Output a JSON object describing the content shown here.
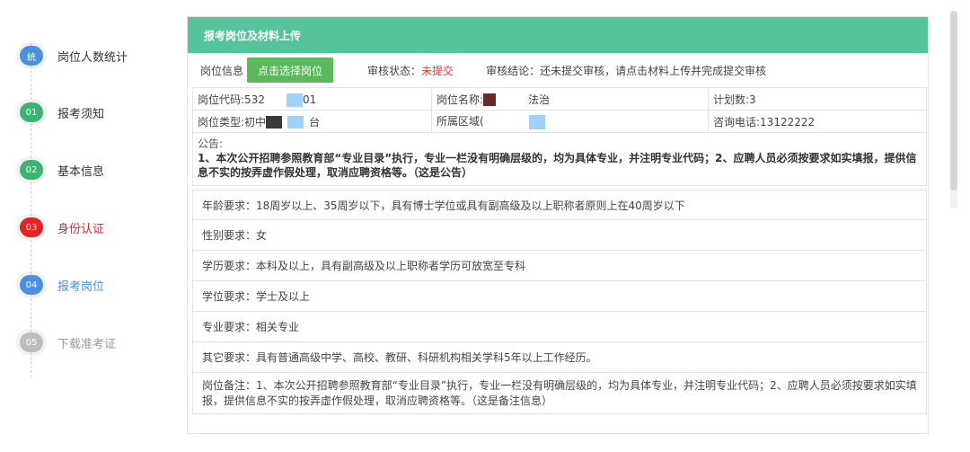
{
  "steps": [
    {
      "badge": "统",
      "label": "岗位人数统计",
      "badge_color": "#4a8fe0",
      "label_color": "#333333"
    },
    {
      "badge": "01",
      "label": "报考须知",
      "badge_color": "#3cb371",
      "label_color": "#333333"
    },
    {
      "badge": "02",
      "label": "基本信息",
      "badge_color": "#3cb371",
      "label_color": "#333333"
    },
    {
      "badge": "03",
      "label": "身份认证",
      "badge_color": "#e22424",
      "label_color": "#e22424"
    },
    {
      "badge": "04",
      "label": "报考岗位",
      "badge_color": "#4a8fe0",
      "label_color": "#4a8fe0"
    },
    {
      "badge": "05",
      "label": "下载准考证",
      "badge_color": "#bdbdbd",
      "label_color": "#999999"
    }
  ],
  "panel": {
    "title": "报考岗位及材料上传",
    "status_bar": {
      "position_label": "岗位信息",
      "select_button": "点击选择岗位",
      "status_label": "审核状态：",
      "status_value": "未提交",
      "conclusion": "审核结论：还未提交审核，请点击材料上传并完成提交审核"
    },
    "info": {
      "code_prefix": "岗位代码:532",
      "code_suffix": "01",
      "name_prefix": "岗位名称:",
      "name_suffix": "法治",
      "plan": "计划数:3",
      "type_prefix": "岗位类型:初中",
      "type_suffix": "台",
      "area_prefix": "所属区域(",
      "phone": "咨询电话:13122222"
    },
    "notice_title": "公告:",
    "notice_body": "1、本次公开招聘参照教育部“专业目录”执行，专业一栏没有明确层级的，均为具体专业，并注明专业代码；2、应聘人员必须按要求如实填报，提供信息不实的按弄虚作假处理，取消应聘资格等。（这是公告）",
    "requirements": [
      "年龄要求：18周岁以上、35周岁以下，具有博士学位或具有副高级及以上职称者原则上在40周岁以下",
      "性别要求：女",
      "学历要求：本科及以上，具有副高级及以上职称者学历可放宽至专科",
      "学位要求：学士及以上",
      "专业要求：相关专业",
      "其它要求：具有普通高级中学、高校、教研、科研机构相关学科5年以上工作经历。"
    ],
    "remark": "岗位备注：1、本次公开招聘参照教育部“专业目录”执行，专业一栏没有明确层级的，均为具体专业，并注明专业代码；2、应聘人员必须按要求如实填报，提供信息不实的按弄虚作假处理，取消应聘资格等。（这是备注信息）"
  },
  "colors": {
    "header": "#56c49a",
    "button": "#5cb85c",
    "status_red": "#e23b3b"
  }
}
